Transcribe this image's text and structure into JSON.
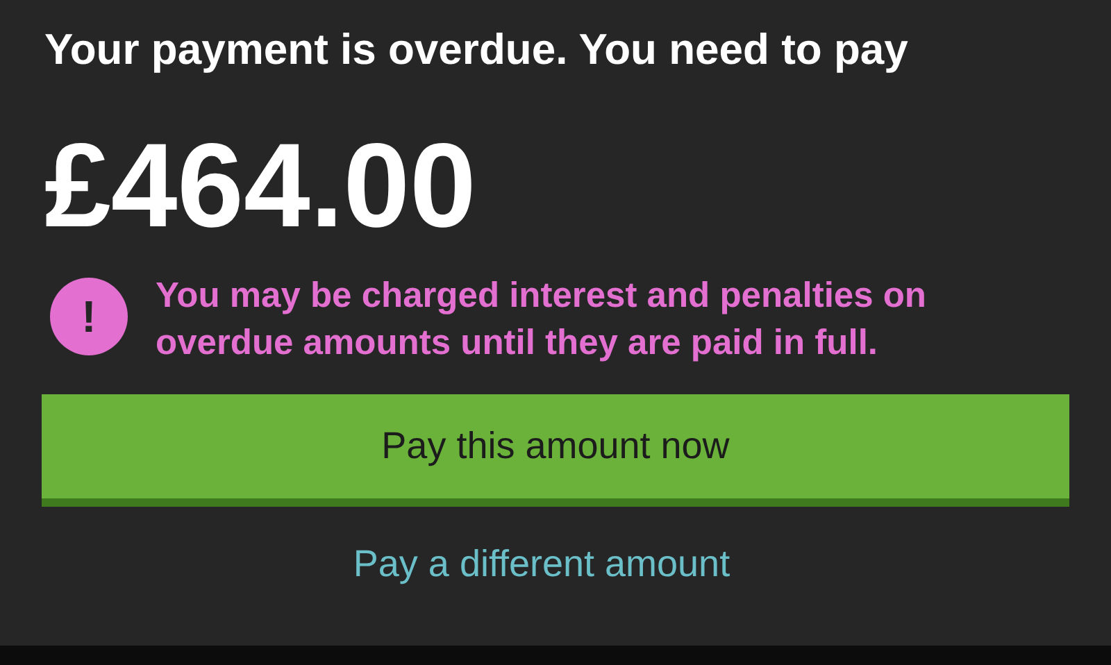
{
  "heading": "Your payment is overdue. You need to pay",
  "amount": "£464.00",
  "warning": {
    "icon": "!",
    "text": "You may be charged interest and penalties on overdue amounts until they are paid in full."
  },
  "primary_button": "Pay this amount now",
  "secondary_link": "Pay a different amount"
}
